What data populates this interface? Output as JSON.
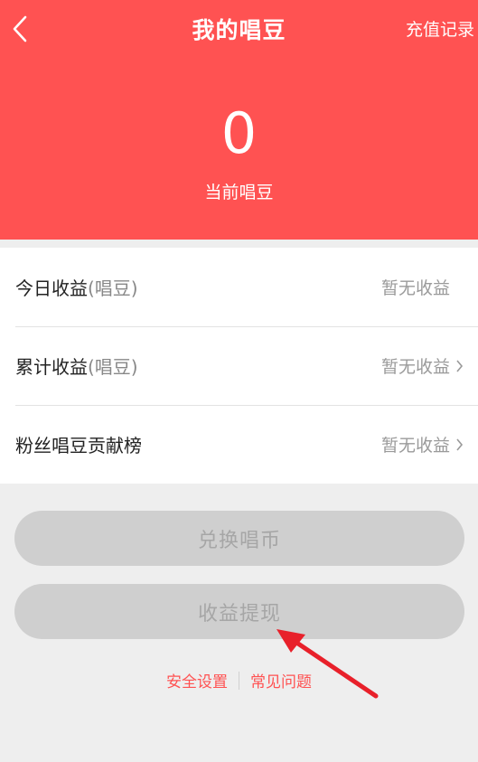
{
  "header": {
    "title": "我的唱豆",
    "recharge_link": "充值记录",
    "balance": "0",
    "balance_label": "当前唱豆"
  },
  "list": {
    "rows": [
      {
        "label": "今日收益",
        "unit": "(唱豆)",
        "value": "暂无收益"
      },
      {
        "label": "累计收益",
        "unit": "(唱豆)",
        "value": "暂无收益"
      },
      {
        "label": "粉丝唱豆贡献榜",
        "unit": "",
        "value": "暂无收益"
      }
    ]
  },
  "buttons": {
    "exchange": "兑换唱币",
    "withdraw": "收益提现"
  },
  "footer": {
    "security": "安全设置",
    "faq": "常见问题"
  },
  "colors": {
    "brand": "#ff5252",
    "disabled_button": "#cfcfcf",
    "annotation_arrow": "#e8202a"
  }
}
